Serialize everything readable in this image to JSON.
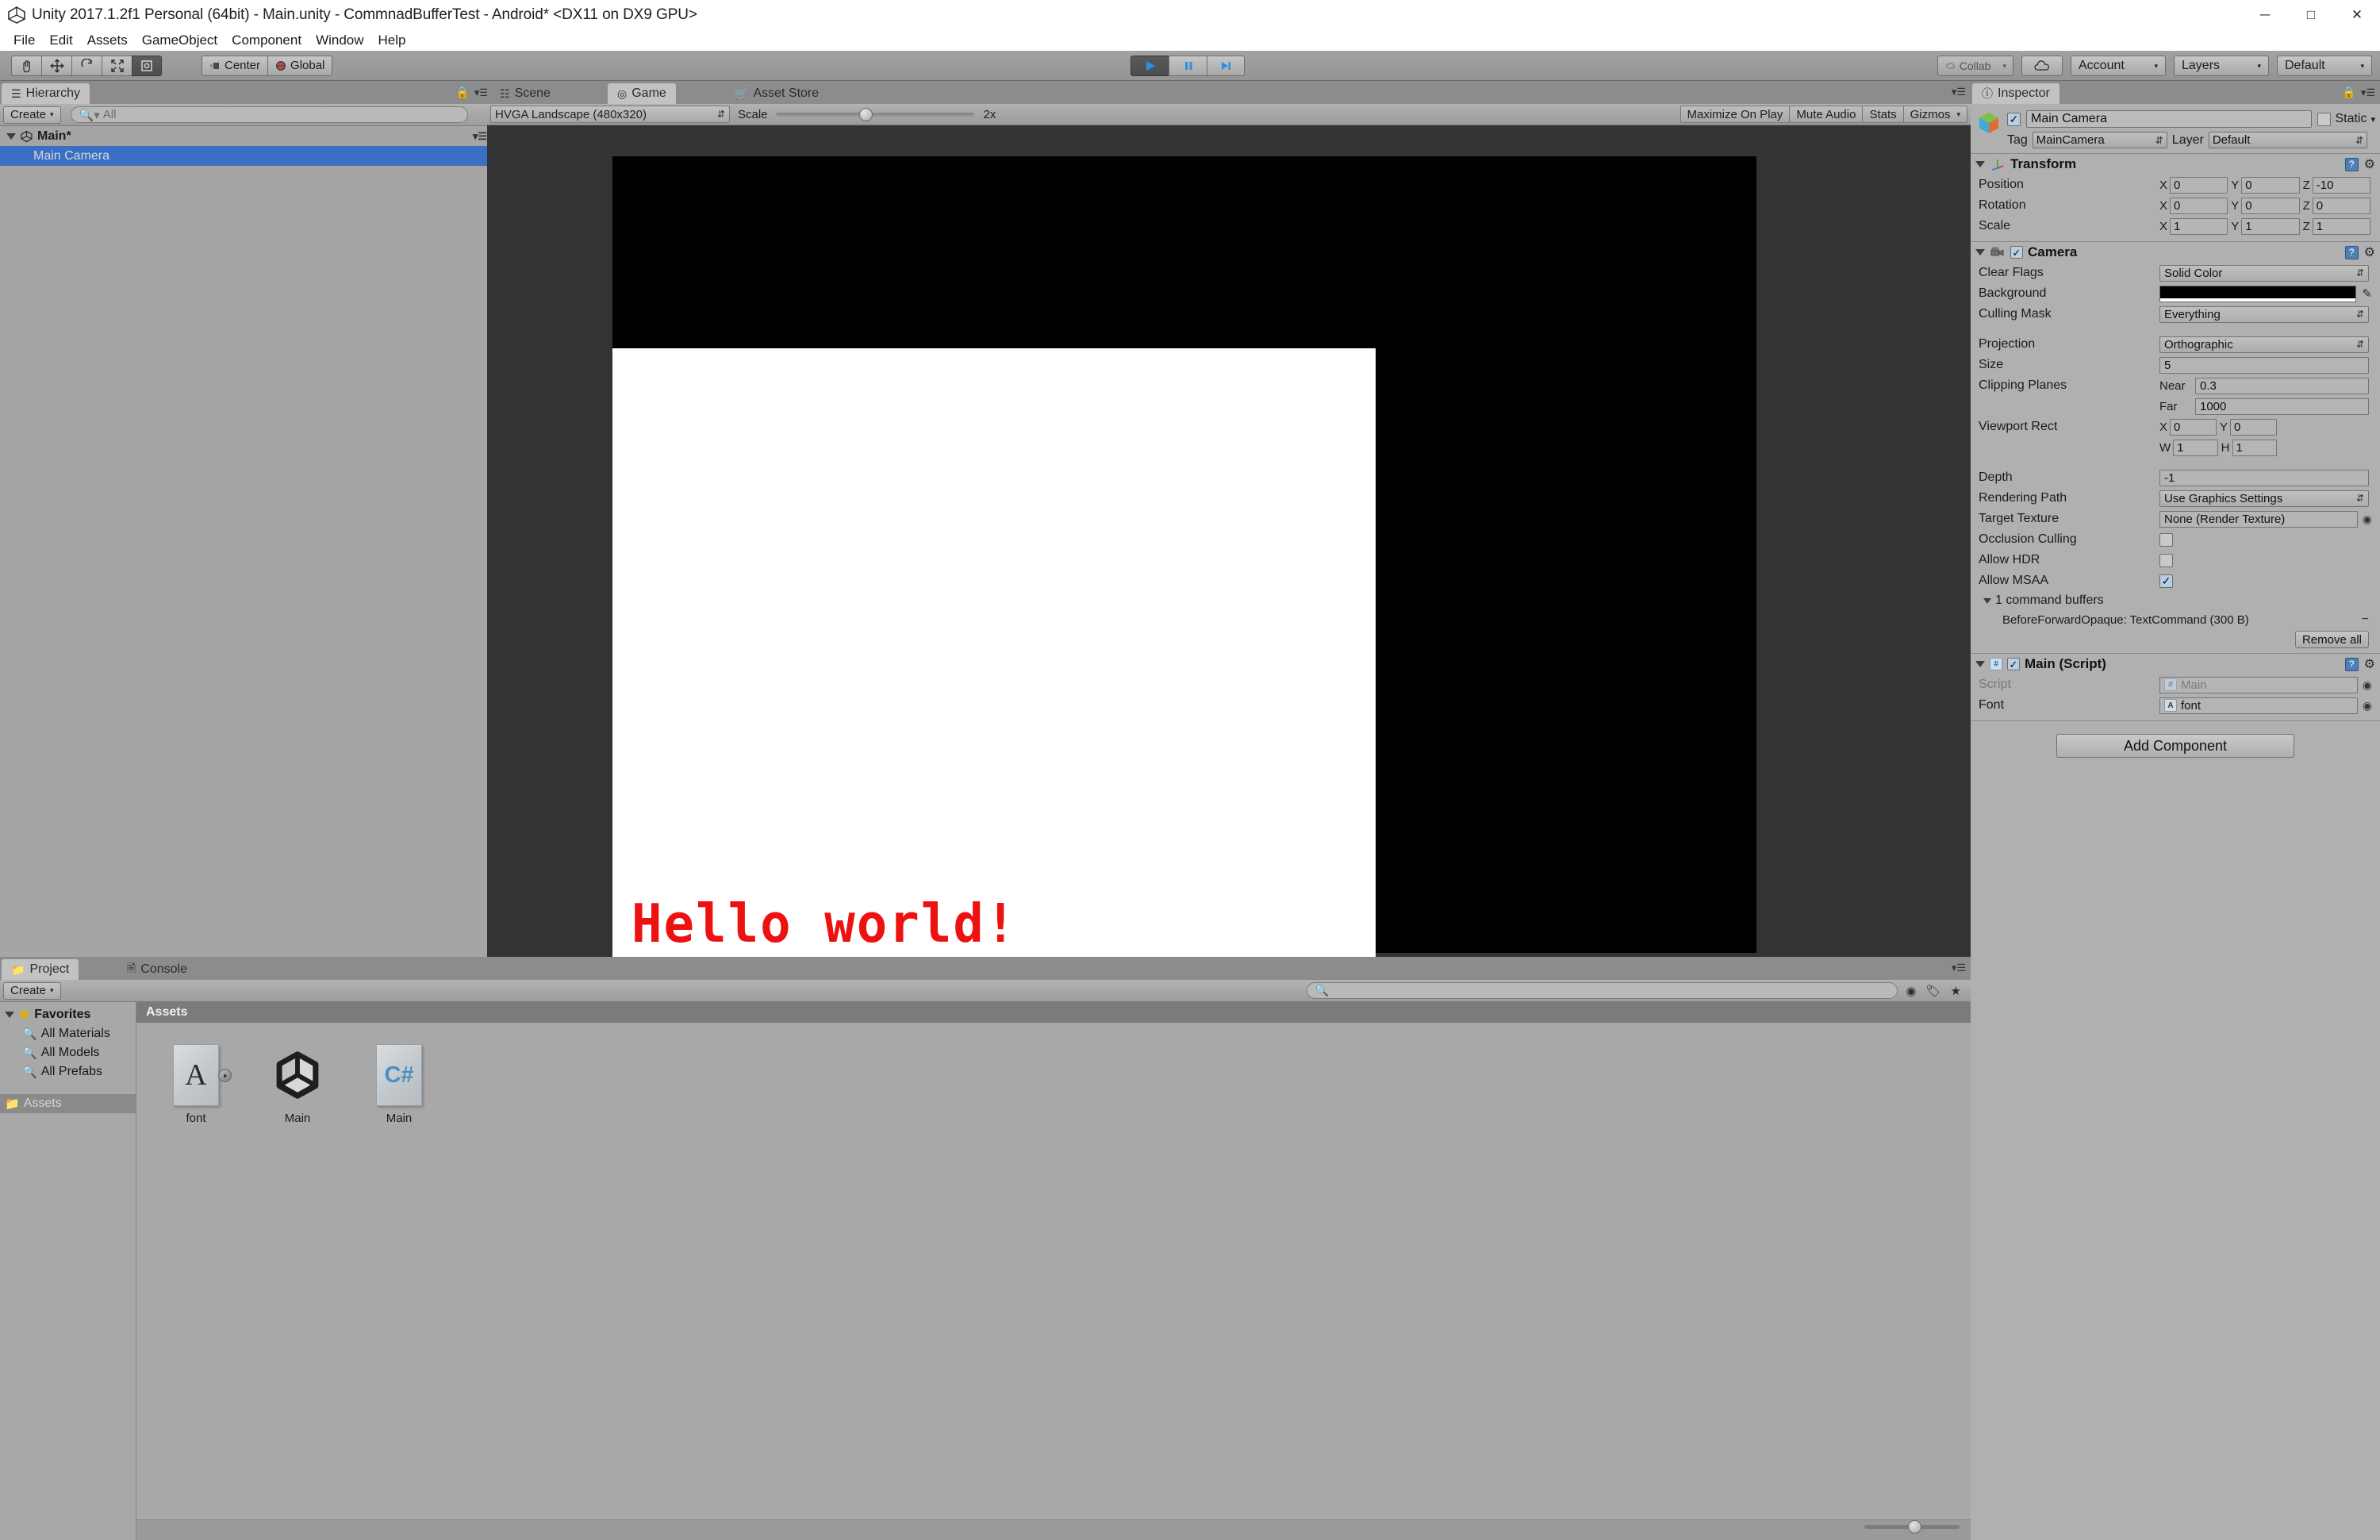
{
  "window": {
    "title": "Unity 2017.1.2f1 Personal (64bit) - Main.unity - CommnadBufferTest - Android* <DX11 on DX9 GPU>",
    "minimize": "─",
    "maximize": "□",
    "close": "✕"
  },
  "menubar": {
    "items": [
      {
        "label": "File"
      },
      {
        "label": "Edit"
      },
      {
        "label": "Assets"
      },
      {
        "label": "GameObject"
      },
      {
        "label": "Component"
      },
      {
        "label": "Window"
      },
      {
        "label": "Help"
      }
    ]
  },
  "toolbar": {
    "tools": [
      {
        "name": "hand-tool",
        "glyph": "✋",
        "active": false
      },
      {
        "name": "move-tool",
        "glyph": "✥",
        "active": false
      },
      {
        "name": "rotate-tool",
        "glyph": "↻",
        "active": false
      },
      {
        "name": "scale-tool",
        "glyph": "⛶",
        "active": false
      },
      {
        "name": "rect-tool",
        "glyph": "▣",
        "active": true
      }
    ],
    "pivot_label": "Center",
    "space_label": "Global",
    "play": "▶",
    "pause": "Ⅱ",
    "step": "▶|",
    "collab_label": "Collab",
    "cloud_label": "cloud",
    "account_label": "Account",
    "layers_label": "Layers",
    "layout_label": "Default"
  },
  "hierarchy": {
    "tab_label": "Hierarchy",
    "create_label": "Create",
    "search_placeholder": "All",
    "scene_name": "Main*",
    "objects": [
      {
        "label": "Main Camera",
        "selected": true
      }
    ]
  },
  "gameview": {
    "tabs": [
      {
        "label": "Scene",
        "icon": "grid-icon",
        "active": false
      },
      {
        "label": "Game",
        "icon": "gamepad-icon",
        "active": true
      },
      {
        "label": "Asset Store",
        "icon": "store-icon",
        "active": false
      }
    ],
    "aspect": "HVGA Landscape (480x320)",
    "scale_label": "Scale",
    "scale_value": "2x",
    "buttons": [
      {
        "label": "Maximize On Play"
      },
      {
        "label": "Mute Audio"
      },
      {
        "label": "Stats"
      },
      {
        "label": "Gizmos"
      }
    ],
    "rendered_text": "Hello world!",
    "text_color": "#ee1111",
    "background_color": "#000000",
    "quad_color": "#ffffff"
  },
  "inspector": {
    "tab_label": "Inspector",
    "object_name": "Main Camera",
    "object_enabled": true,
    "static_label": "Static",
    "static_checked": false,
    "tag_label": "Tag",
    "tag_value": "MainCamera",
    "layer_label": "Layer",
    "layer_value": "Default",
    "transform": {
      "title": "Transform",
      "rows": [
        {
          "label": "Position",
          "x": "0",
          "y": "0",
          "z": "-10"
        },
        {
          "label": "Rotation",
          "x": "0",
          "y": "0",
          "z": "0"
        },
        {
          "label": "Scale",
          "x": "1",
          "y": "1",
          "z": "1"
        }
      ]
    },
    "camera": {
      "title": "Camera",
      "enabled": true,
      "clear_flags_label": "Clear Flags",
      "clear_flags_value": "Solid Color",
      "background_label": "Background",
      "background_color": "#000000",
      "culling_mask_label": "Culling Mask",
      "culling_mask_value": "Everything",
      "projection_label": "Projection",
      "projection_value": "Orthographic",
      "size_label": "Size",
      "size_value": "5",
      "clipping_label": "Clipping Planes",
      "near_label": "Near",
      "near_value": "0.3",
      "far_label": "Far",
      "far_value": "1000",
      "viewport_label": "Viewport Rect",
      "viewport_x": "0",
      "viewport_y": "0",
      "viewport_w": "1",
      "viewport_h": "1",
      "depth_label": "Depth",
      "depth_value": "-1",
      "rendering_path_label": "Rendering Path",
      "rendering_path_value": "Use Graphics Settings",
      "target_texture_label": "Target Texture",
      "target_texture_value": "None (Render Texture)",
      "occlusion_label": "Occlusion Culling",
      "occlusion_checked": false,
      "hdr_label": "Allow HDR",
      "hdr_checked": false,
      "msaa_label": "Allow MSAA",
      "msaa_checked": true,
      "cmdbuf_header": "1 command buffers",
      "cmdbuf_entry": "BeforeForwardOpaque: TextCommand (300 B)",
      "remove_all_label": "Remove all"
    },
    "script": {
      "title": "Main (Script)",
      "enabled": true,
      "script_label": "Script",
      "script_value": "Main",
      "font_label": "Font",
      "font_value": "font"
    },
    "add_component_label": "Add Component"
  },
  "project": {
    "tabs": [
      {
        "label": "Project",
        "active": true
      },
      {
        "label": "Console",
        "active": false
      }
    ],
    "create_label": "Create",
    "search_placeholder": "",
    "tree": [
      {
        "label": "Favorites",
        "type": "star",
        "bold": true,
        "selected": false
      },
      {
        "label": "All Materials",
        "type": "search",
        "bold": false,
        "selected": false
      },
      {
        "label": "All Models",
        "type": "search",
        "bold": false,
        "selected": false
      },
      {
        "label": "All Prefabs",
        "type": "search",
        "bold": false,
        "selected": false
      },
      {
        "label": "Assets",
        "type": "folder",
        "bold": false,
        "selected": true
      }
    ],
    "breadcrumb": "Assets",
    "assets": [
      {
        "label": "font",
        "kind": "font-asset",
        "glyph": "A",
        "expandable": true
      },
      {
        "label": "Main",
        "kind": "scene-asset",
        "glyph": "unity",
        "expandable": false
      },
      {
        "label": "Main",
        "kind": "csharp-asset",
        "glyph": "C#",
        "expandable": false
      }
    ]
  }
}
